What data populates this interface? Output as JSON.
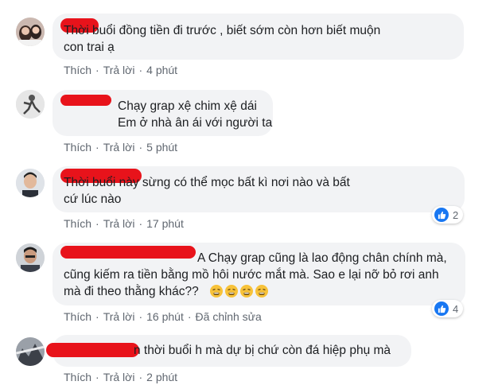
{
  "comments": [
    {
      "text": "Thời buổi đồng tiền đi trước , biết sớm còn hơn biết muộn\ncon trai ạ",
      "actions": {
        "like": "Thích",
        "reply": "Trả lời",
        "time": "4 phút"
      }
    },
    {
      "text": "Chạy grap xệ chim xệ dái\nEm ở nhà ân ái với người ta",
      "actions": {
        "like": "Thích",
        "reply": "Trả lời",
        "time": "5 phút"
      }
    },
    {
      "text": "Thời buổi này sừng có thể mọc bất kì nơi nào và bất\ncứ lúc nào",
      "actions": {
        "like": "Thích",
        "reply": "Trả lời",
        "time": "17 phút"
      },
      "reaction_count": "2"
    },
    {
      "text_line1": "A Chạy grap cũng là lao động chân chính mà,",
      "text_rest": "cũng kiếm ra tiền bằng mồ hôi nước mắt mà. Sao e lại nỡ bỏ rơi anh\nmà đi theo thằng khác??",
      "actions": {
        "like": "Thích",
        "reply": "Trả lời",
        "time": "16 phút",
        "edited": "Đã chỉnh sửa"
      },
      "reaction_count": "4",
      "emoji_count": 4
    },
    {
      "text": "n thời buổi h mà dự bị chứ còn đá hiệp phụ mà",
      "actions": {
        "like": "Thích",
        "reply": "Trả lời",
        "time": "2 phút"
      }
    }
  ],
  "colors": {
    "redaction": "#e8131b",
    "like_blue": "#1877f2",
    "bubble": "#f2f3f5",
    "meta": "#606770"
  },
  "icons": [
    "like-thumb-icon",
    "weary-face-emoji-icon"
  ]
}
